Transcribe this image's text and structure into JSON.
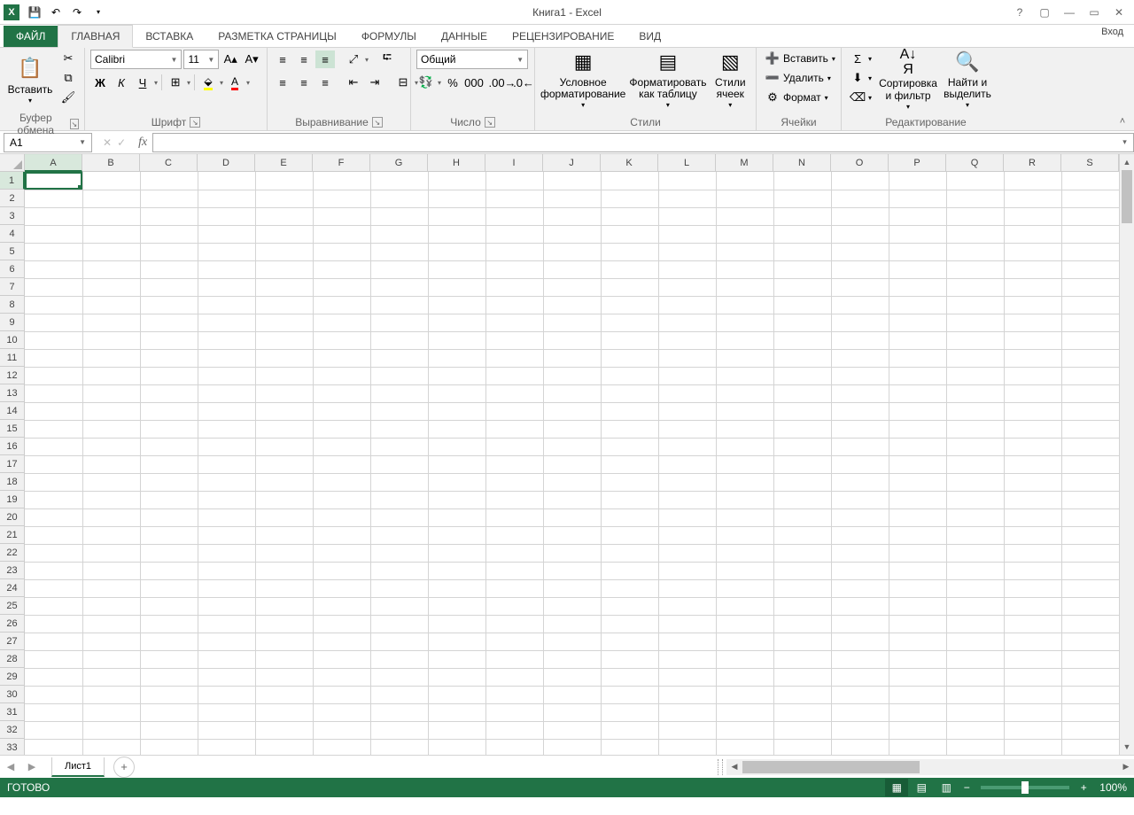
{
  "title": "Книга1 - Excel",
  "signin": "Вход",
  "qa": {
    "save": "💾",
    "undo": "↶",
    "redo": "↷",
    "customize": "▾"
  },
  "tabs": [
    "ФАЙЛ",
    "ГЛАВНАЯ",
    "ВСТАВКА",
    "РАЗМЕТКА СТРАНИЦЫ",
    "ФОРМУЛЫ",
    "ДАННЫЕ",
    "РЕЦЕНЗИРОВАНИЕ",
    "ВИД"
  ],
  "activeTab": 1,
  "ribbon": {
    "clipboard": {
      "label": "Буфер обмена",
      "paste": "Вставить"
    },
    "font": {
      "label": "Шрифт",
      "name": "Calibri",
      "size": "11"
    },
    "align": {
      "label": "Выравнивание"
    },
    "number": {
      "label": "Число",
      "format": "Общий"
    },
    "styles": {
      "label": "Стили",
      "cond": "Условное форматирование",
      "table": "Форматировать как таблицу",
      "cell": "Стили ячеек"
    },
    "cells": {
      "label": "Ячейки",
      "insert": "Вставить",
      "delete": "Удалить",
      "format": "Формат"
    },
    "editing": {
      "label": "Редактирование",
      "sort": "Сортировка и фильтр",
      "find": "Найти и выделить"
    }
  },
  "namebox": "A1",
  "columns": [
    "A",
    "B",
    "C",
    "D",
    "E",
    "F",
    "G",
    "H",
    "I",
    "J",
    "K",
    "L",
    "M",
    "N",
    "O",
    "P",
    "Q",
    "R",
    "S"
  ],
  "rows": 33,
  "sheet": "Лист1",
  "status": "ГОТОВО",
  "zoom": "100%"
}
